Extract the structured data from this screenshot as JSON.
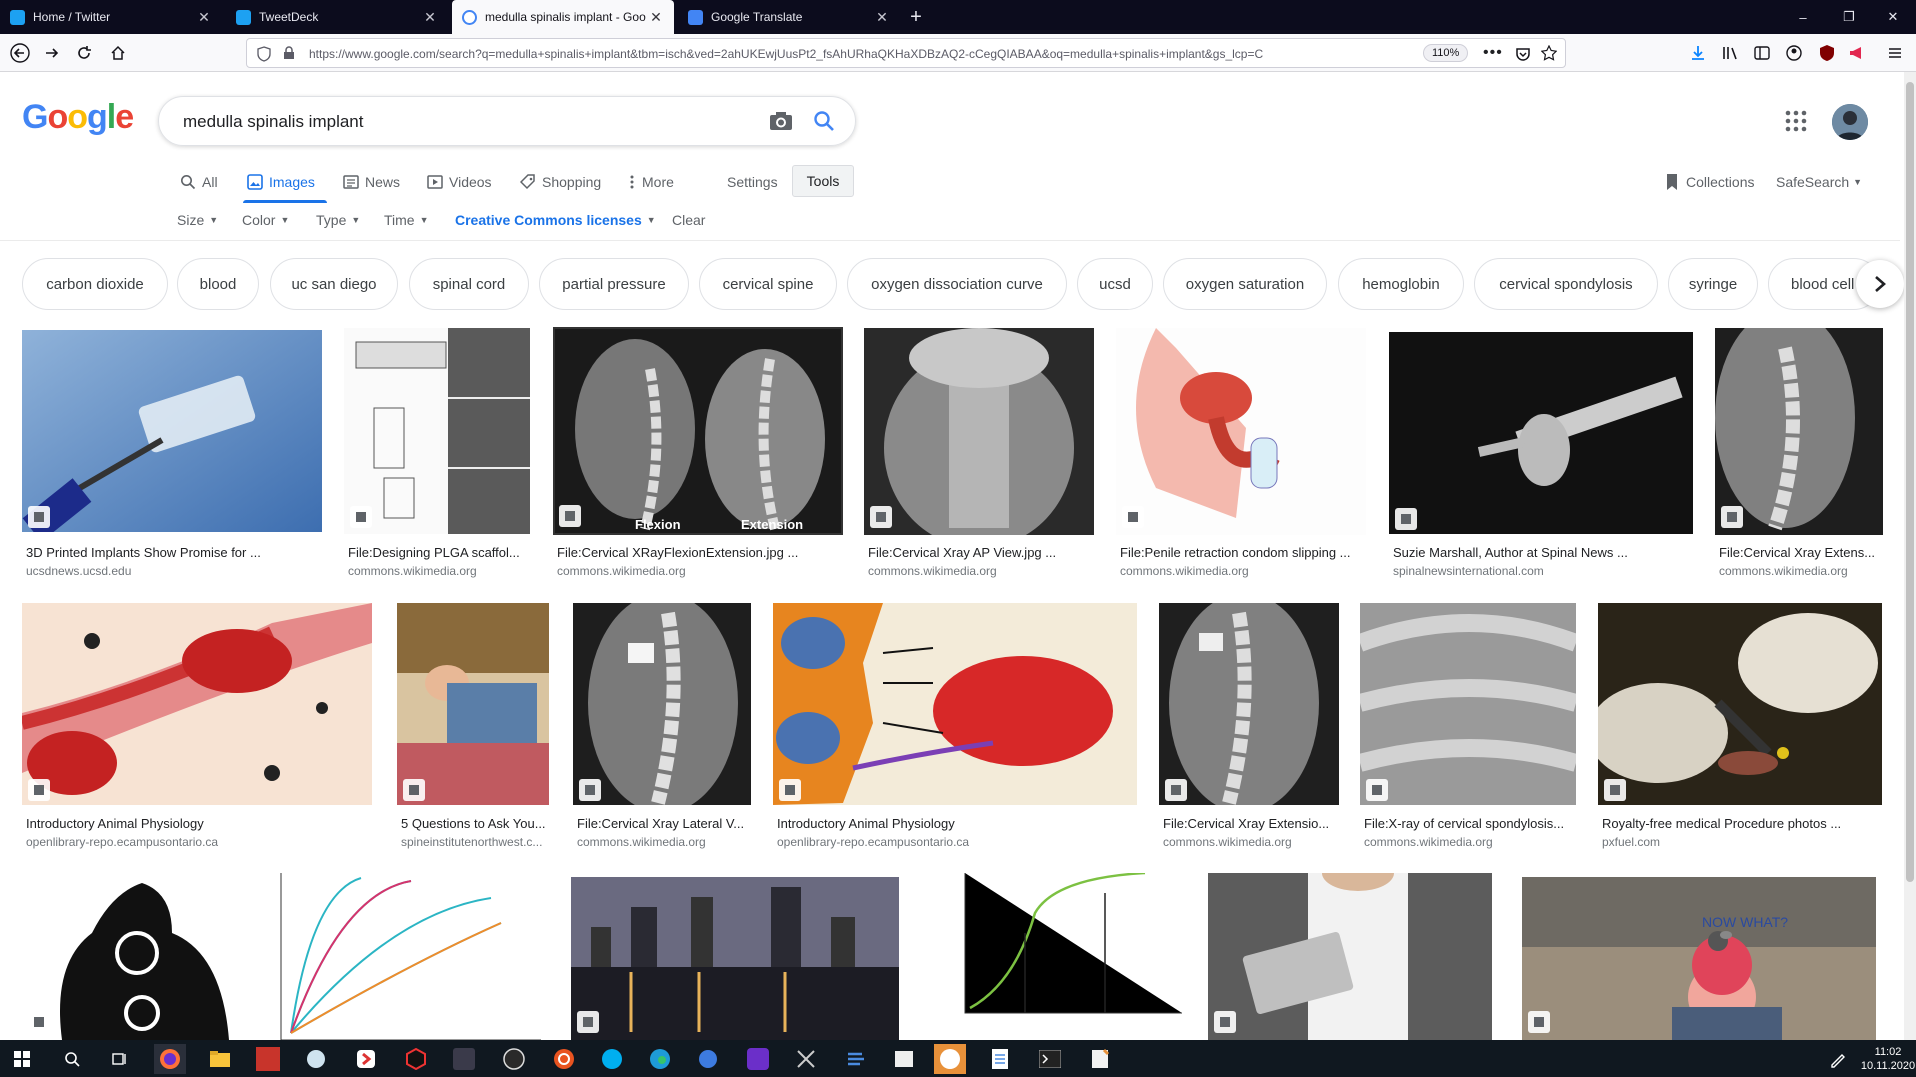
{
  "browser": {
    "tabs": [
      {
        "title": "Home / Twitter",
        "active": false
      },
      {
        "title": "TweetDeck",
        "active": false
      },
      {
        "title": "medulla spinalis implant - Goo",
        "active": true
      },
      {
        "title": "Google Translate",
        "active": false
      }
    ],
    "new_tab": "+",
    "url": "https://www.google.com/search?q=medulla+spinalis+implant&tbm=isch&ved=2ahUKEwjUusPt2_fsAhURhaQKHaXDBzAQ2-cCegQIABAA&oq=medulla+spinalis+implant&gs_lcp=C",
    "zoom": "110%",
    "window_controls": [
      "–",
      "❐",
      "✕"
    ]
  },
  "google": {
    "logo": [
      "G",
      "o",
      "o",
      "g",
      "l",
      "e"
    ],
    "logo_colors": [
      "#4285f4",
      "#ea4335",
      "#fbbc05",
      "#4285f4",
      "#34a853",
      "#ea4335"
    ],
    "query": "medulla spinalis implant",
    "tabs": [
      "All",
      "Images",
      "News",
      "Videos",
      "Shopping",
      "More"
    ],
    "settings": "Settings",
    "tools": "Tools",
    "collections": "Collections",
    "safesearch": "SafeSearch",
    "filters": {
      "size": "Size",
      "color": "Color",
      "type": "Type",
      "time": "Time",
      "license": "Creative Commons licenses",
      "clear": "Clear"
    },
    "chips": [
      "carbon dioxide",
      "blood",
      "uc san diego",
      "spinal cord",
      "partial pressure",
      "cervical spine",
      "oxygen dissociation curve",
      "ucsd",
      "oxygen saturation",
      "hemoglobin",
      "cervical spondylosis",
      "syringe",
      "blood cell"
    ],
    "results_row1": [
      {
        "title": "3D Printed Implants Show Promise for ...",
        "source": "ucsdnews.ucsd.edu"
      },
      {
        "title": "File:Designing PLGA scaffol...",
        "source": "commons.wikimedia.org"
      },
      {
        "title": "File:Cervical XRayFlexionExtension.jpg ...",
        "source": "commons.wikimedia.org"
      },
      {
        "title": "File:Cervical Xray AP View.jpg ...",
        "source": "commons.wikimedia.org"
      },
      {
        "title": "File:Penile retraction condom slipping ...",
        "source": "commons.wikimedia.org"
      },
      {
        "title": "Suzie Marshall, Author at Spinal News ...",
        "source": "spinalnewsinternational.com"
      },
      {
        "title": "File:Cervical Xray Extens...",
        "source": "commons.wikimedia.org"
      }
    ],
    "results_row2": [
      {
        "title": "Introductory Animal Physiology",
        "source": "openlibrary-repo.ecampusontario.ca"
      },
      {
        "title": "5 Questions to Ask You...",
        "source": "spineinstitutenorthwest.c..."
      },
      {
        "title": "File:Cervical Xray Lateral V...",
        "source": "commons.wikimedia.org"
      },
      {
        "title": "Introductory Animal Physiology",
        "source": "openlibrary-repo.ecampusontario.ca"
      },
      {
        "title": "File:Cervical Xray Extensio...",
        "source": "commons.wikimedia.org"
      },
      {
        "title": "File:X-ray of cervical spondylosis...",
        "source": "commons.wikimedia.org"
      },
      {
        "title": "Royalty-free medical Procedure photos ...",
        "source": "pxfuel.com"
      }
    ],
    "image_text": {
      "flexion": "Flexion",
      "extension": "Extension",
      "now_what": "NOW WHAT?"
    }
  },
  "taskbar": {
    "time": "11:02",
    "date": "10.11.2020"
  }
}
